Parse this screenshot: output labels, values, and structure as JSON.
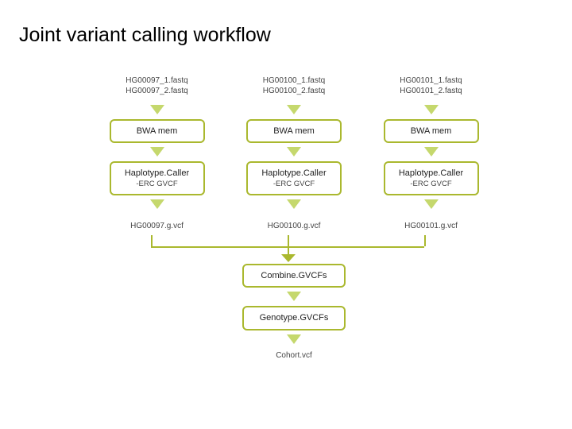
{
  "title": "Joint variant calling workflow",
  "lanes": [
    {
      "input1": "HG00097_1.fastq",
      "input2": "HG00097_2.fastq",
      "step1": "BWA mem",
      "step2": "Haplotype.Caller",
      "step2sub": "-ERC GVCF",
      "gvcf": "HG00097.g.vcf"
    },
    {
      "input1": "HG00100_1.fastq",
      "input2": "HG00100_2.fastq",
      "step1": "BWA mem",
      "step2": "Haplotype.Caller",
      "step2sub": "-ERC GVCF",
      "gvcf": "HG00100.g.vcf"
    },
    {
      "input1": "HG00101_1.fastq",
      "input2": "HG00101_2.fastq",
      "step1": "BWA mem",
      "step2": "Haplotype.Caller",
      "step2sub": "-ERC GVCF",
      "gvcf": "HG00101.g.vcf"
    }
  ],
  "combine": "Combine.GVCFs",
  "genotype": "Genotype.GVCFs",
  "output": "Cohort.vcf"
}
